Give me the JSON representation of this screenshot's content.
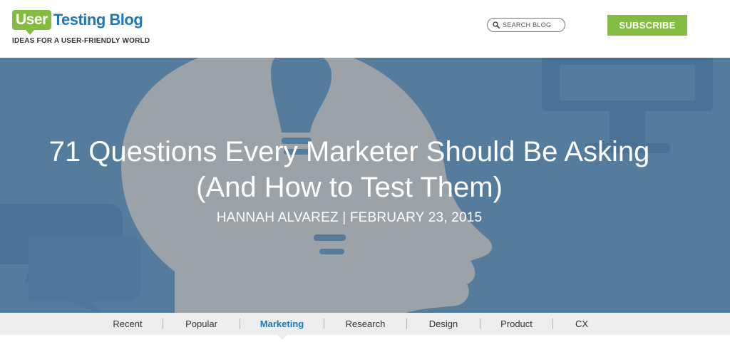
{
  "header": {
    "logo_user": "User",
    "logo_rest": "Testing Blog",
    "tagline": "IDEAS FOR A USER-FRIENDLY WORLD",
    "search_placeholder": "SEARCH BLOG",
    "subscribe_label": "SUBSCRIBE"
  },
  "hero": {
    "title": "71 Questions Every Marketer Should Be Asking (And How to Test Them)",
    "meta": "HANNAH ALVAREZ | FEBRUARY 23, 2015",
    "background_icons": [
      "lightbulb-head-icon",
      "monitor-icon",
      "speech-bubble-icon",
      "ab-test-icon"
    ]
  },
  "nav": {
    "active": "Marketing",
    "items": [
      {
        "label": "Recent"
      },
      {
        "label": "Popular"
      },
      {
        "label": "Marketing"
      },
      {
        "label": "Research"
      },
      {
        "label": "Design"
      },
      {
        "label": "Product"
      },
      {
        "label": "CX"
      }
    ]
  },
  "colors": {
    "brand_green": "#82bc41",
    "brand_blue": "#1f77b4",
    "hero_bg": "#5c82a3",
    "nav_bg": "#eeeeee"
  }
}
